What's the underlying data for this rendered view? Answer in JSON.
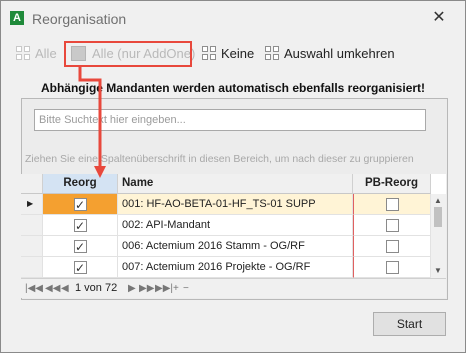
{
  "window": {
    "title": "Reorganisation",
    "app_icon_letter": "A",
    "close_glyph": "✕"
  },
  "toolbar": {
    "all_label": "Alle",
    "all_addone_label": "Alle (nur AddOne)",
    "none_label": "Keine",
    "invert_label": "Auswahl umkehren"
  },
  "warning_text": "Abhängige Mandanten werden automatisch ebenfalls reorganisiert!",
  "search": {
    "placeholder": "Bitte Suchtext hier eingeben..."
  },
  "group_hint": "Ziehen Sie eine Spaltenüberschrift in diesen Bereich, um nach dieser zu gruppieren",
  "grid": {
    "columns": {
      "reorg": "Reorg",
      "name": "Name",
      "pb_reorg": "PB-Reorg"
    },
    "rows": [
      {
        "reorg": true,
        "name": "001: HF-AO-BETA-01-HF_TS-01 SUPP",
        "pb_reorg": false,
        "selected": true
      },
      {
        "reorg": true,
        "name": "002: API-Mandant",
        "pb_reorg": false,
        "selected": false
      },
      {
        "reorg": true,
        "name": "006: Actemium 2016 Stamm - OG/RF",
        "pb_reorg": false,
        "selected": false
      },
      {
        "reorg": true,
        "name": "007: Actemium 2016  Projekte - OG/RF",
        "pb_reorg": false,
        "selected": false
      }
    ],
    "row_indicator": "▶"
  },
  "pager": {
    "first": "|◀◀",
    "prev_page": "◀◀",
    "prev": "◀",
    "text": "1 von 72",
    "next": "▶",
    "next_page": "▶▶",
    "last": "▶▶|",
    "add": "+",
    "remove": "−"
  },
  "start_button": "Start",
  "colors": {
    "highlight": "#e8483c",
    "selected_row": "#fff4d6",
    "selected_cell": "#f4a030",
    "reorg_header": "#d4e3f3",
    "app_icon": "#1f8a3a"
  }
}
